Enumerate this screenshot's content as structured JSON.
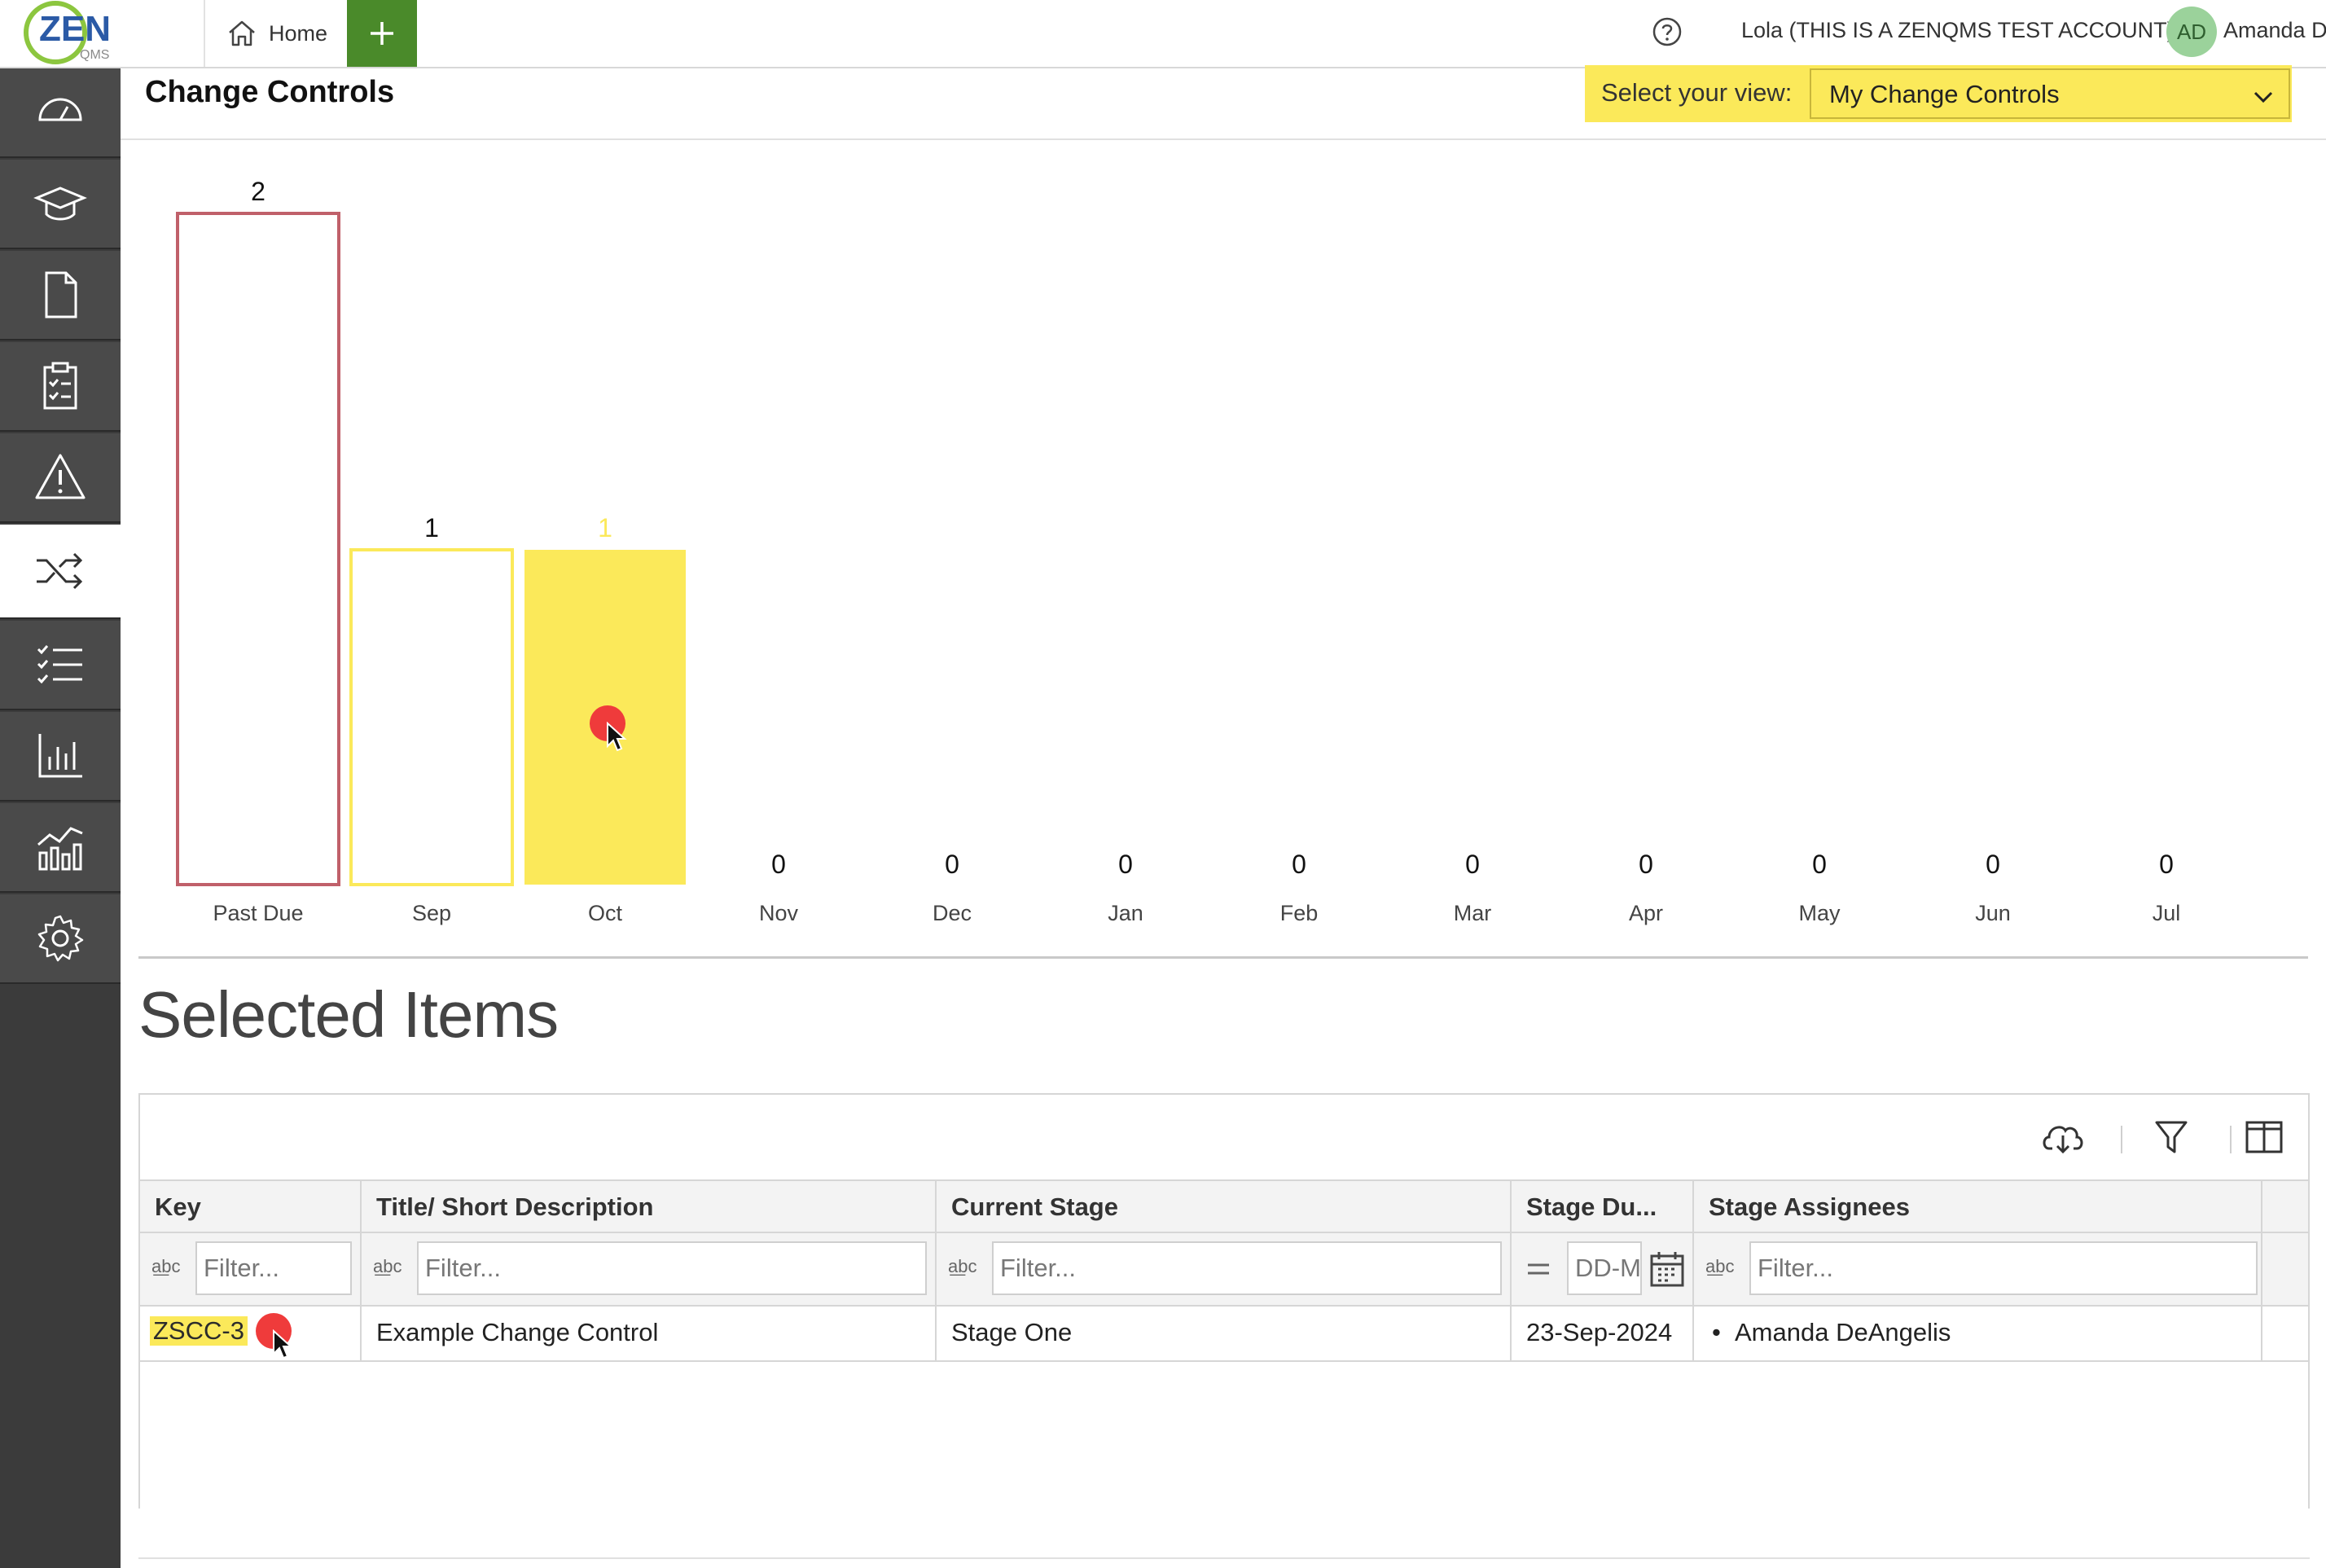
{
  "topbar": {
    "logo_text": "ZEN",
    "logo_sub": "QMS",
    "home_label": "Home",
    "account_label": "Lola (THIS IS A ZENQMS TEST ACCOUNT)",
    "avatar_initials": "AD",
    "user_name": "Amanda D"
  },
  "sidebar": {
    "items": [
      {
        "icon": "dashboard-icon"
      },
      {
        "icon": "training-icon"
      },
      {
        "icon": "document-icon"
      },
      {
        "icon": "checklist-clipboard-icon"
      },
      {
        "icon": "warning-icon"
      },
      {
        "icon": "change-control-icon",
        "active": true
      },
      {
        "icon": "task-list-icon"
      },
      {
        "icon": "bar-chart-icon"
      },
      {
        "icon": "analytics-icon"
      },
      {
        "icon": "settings-icon"
      }
    ]
  },
  "header": {
    "title": "Change Controls",
    "view_label": "Select your view:",
    "view_value": "My Change Controls"
  },
  "chart_data": {
    "type": "bar",
    "categories": [
      "Past Due",
      "Sep",
      "Oct",
      "Nov",
      "Dec",
      "Jan",
      "Feb",
      "Mar",
      "Apr",
      "May",
      "Jun",
      "Jul"
    ],
    "values": [
      2,
      1,
      1,
      0,
      0,
      0,
      0,
      0,
      0,
      0,
      0,
      0
    ],
    "bar_styles": [
      "outline-red",
      "outline-yellow",
      "filled-yellow",
      "none",
      "none",
      "none",
      "none",
      "none",
      "none",
      "none",
      "none",
      "none"
    ],
    "colors": {
      "red": "#c0606a",
      "yellow": "#fbe95a",
      "label": "#111111",
      "selected_label": "#fbe95a"
    },
    "selected_category": "Oct",
    "ylim": [
      0,
      2
    ]
  },
  "selected": {
    "title": "Selected Items",
    "columns": [
      "Key",
      "Title/ Short Description",
      "Current Stage",
      "Stage Du...",
      "Stage Assignees"
    ],
    "filter_placeholder": "Filter...",
    "date_placeholder": "DD-M",
    "rows": [
      {
        "key": "ZSCC-3",
        "title": "Example Change Control",
        "stage": "Stage One",
        "due": "23-Sep-2024",
        "assignee": "Amanda DeAngelis"
      }
    ]
  }
}
